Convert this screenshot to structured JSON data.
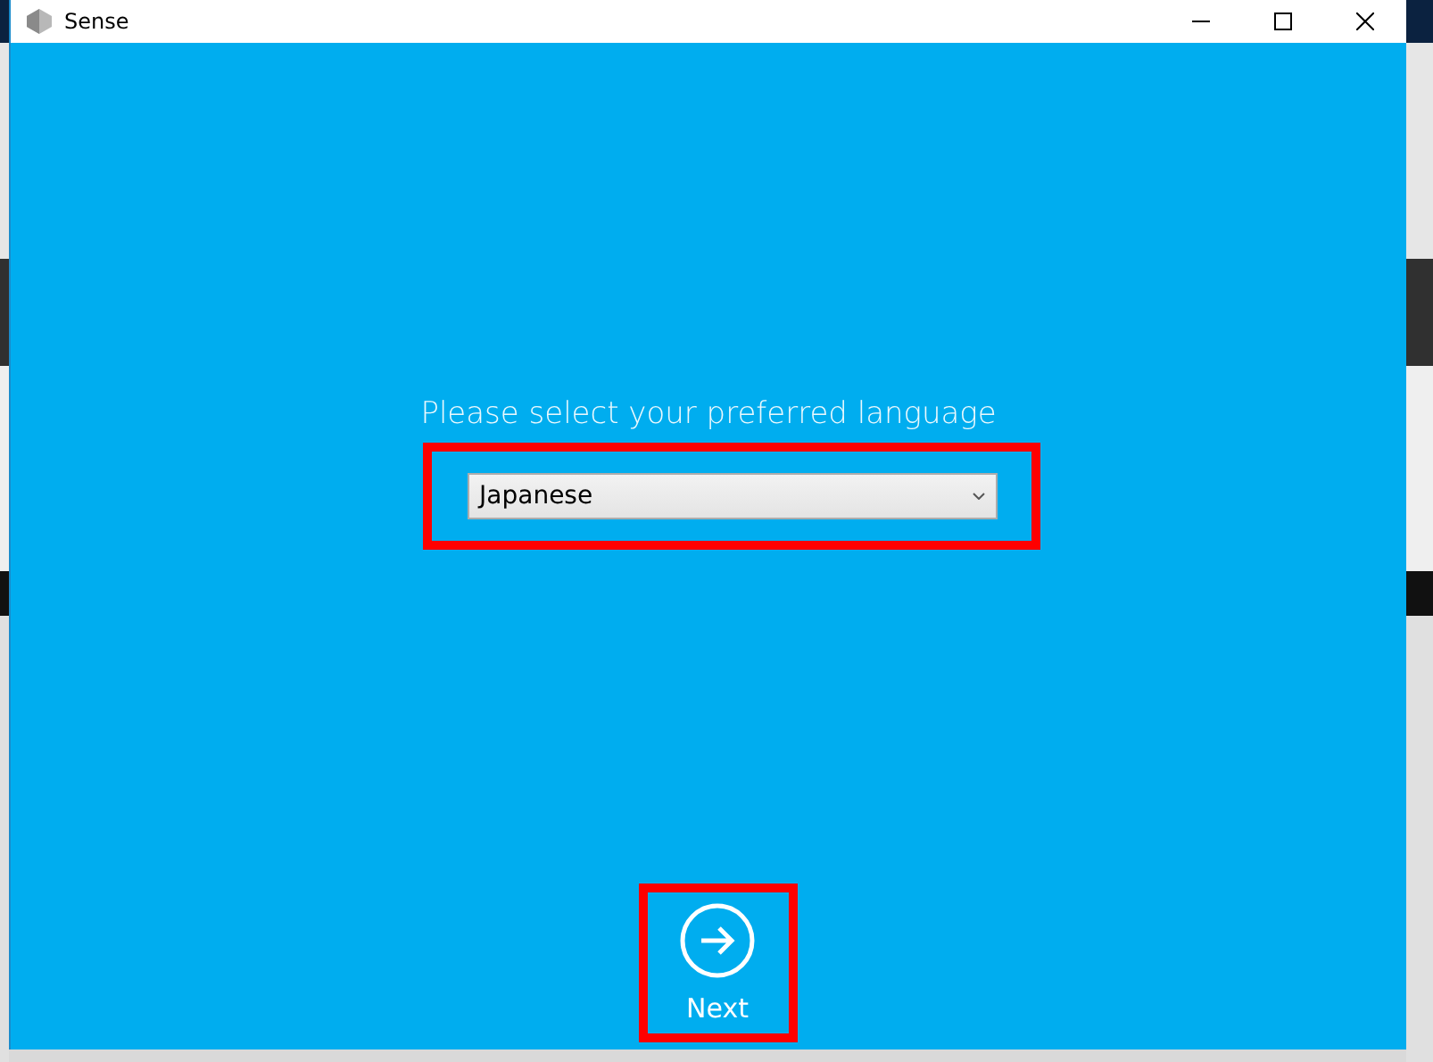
{
  "window": {
    "title": "Sense"
  },
  "prompt": "Please select your preferred language",
  "language_select": {
    "value": "Japanese"
  },
  "next_button": {
    "label": "Next"
  }
}
